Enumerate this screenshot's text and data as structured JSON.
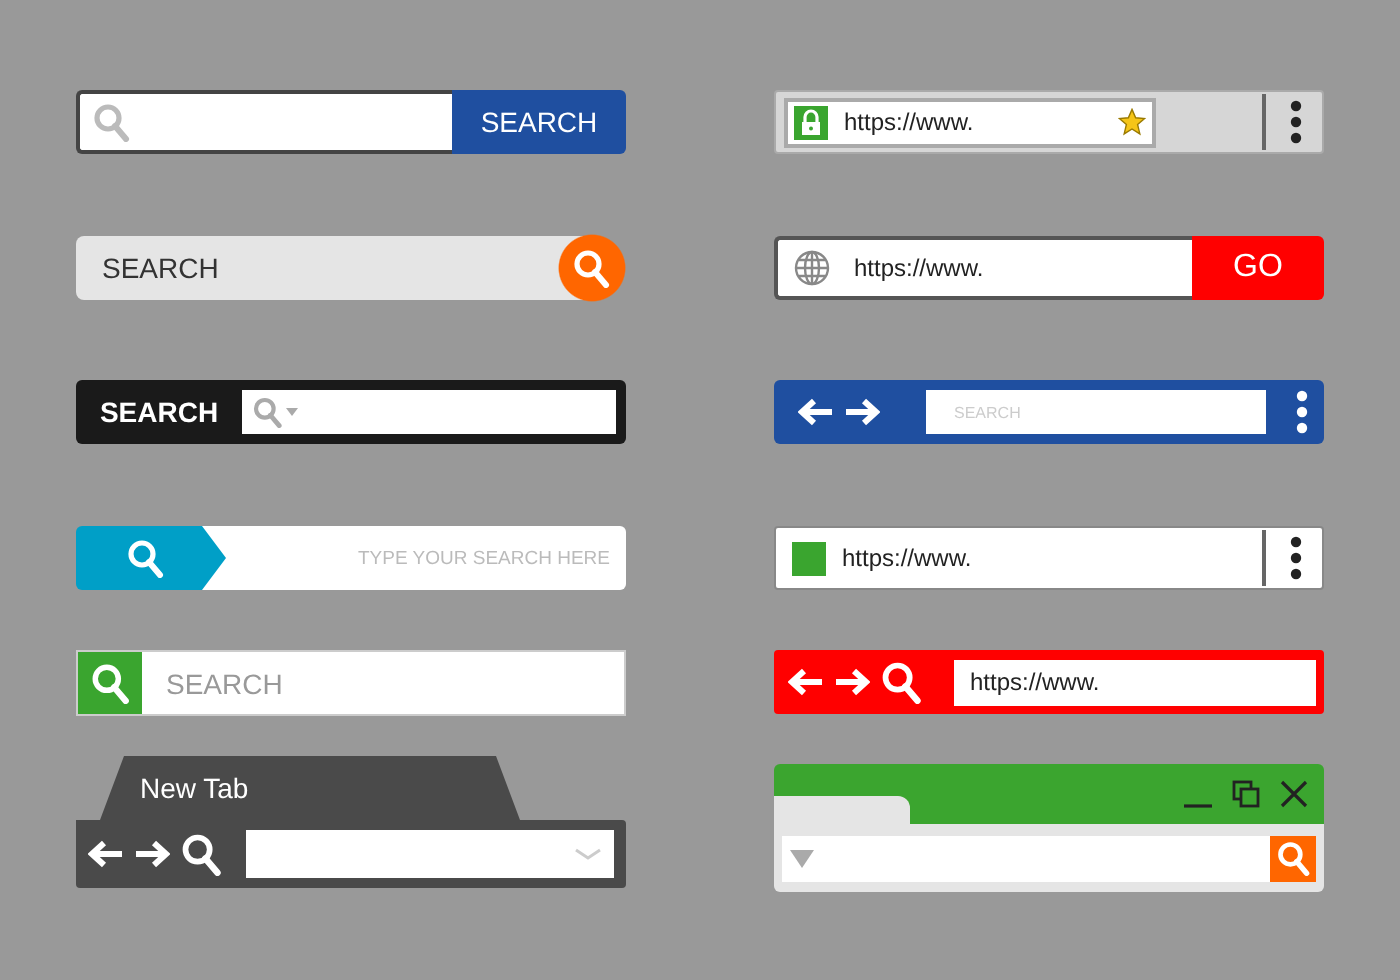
{
  "left": [
    {
      "kind": "search-button",
      "button": "SEARCH"
    },
    {
      "kind": "pill",
      "placeholder": "SEARCH"
    },
    {
      "kind": "dark-label",
      "label": "SEARCH"
    },
    {
      "kind": "arrow-tab",
      "placeholder": "TYPE YOUR SEARCH HERE"
    },
    {
      "kind": "green-icon",
      "placeholder": "SEARCH"
    },
    {
      "kind": "tabbed",
      "tab": "New Tab"
    }
  ],
  "right": [
    {
      "kind": "secure-url",
      "url": "https://www."
    },
    {
      "kind": "globe-go",
      "url": "https://www.",
      "button": "GO"
    },
    {
      "kind": "blue-nav",
      "placeholder": "SEARCH"
    },
    {
      "kind": "square-url",
      "url": "https://www."
    },
    {
      "kind": "red-nav",
      "url": "https://www."
    },
    {
      "kind": "window"
    }
  ]
}
